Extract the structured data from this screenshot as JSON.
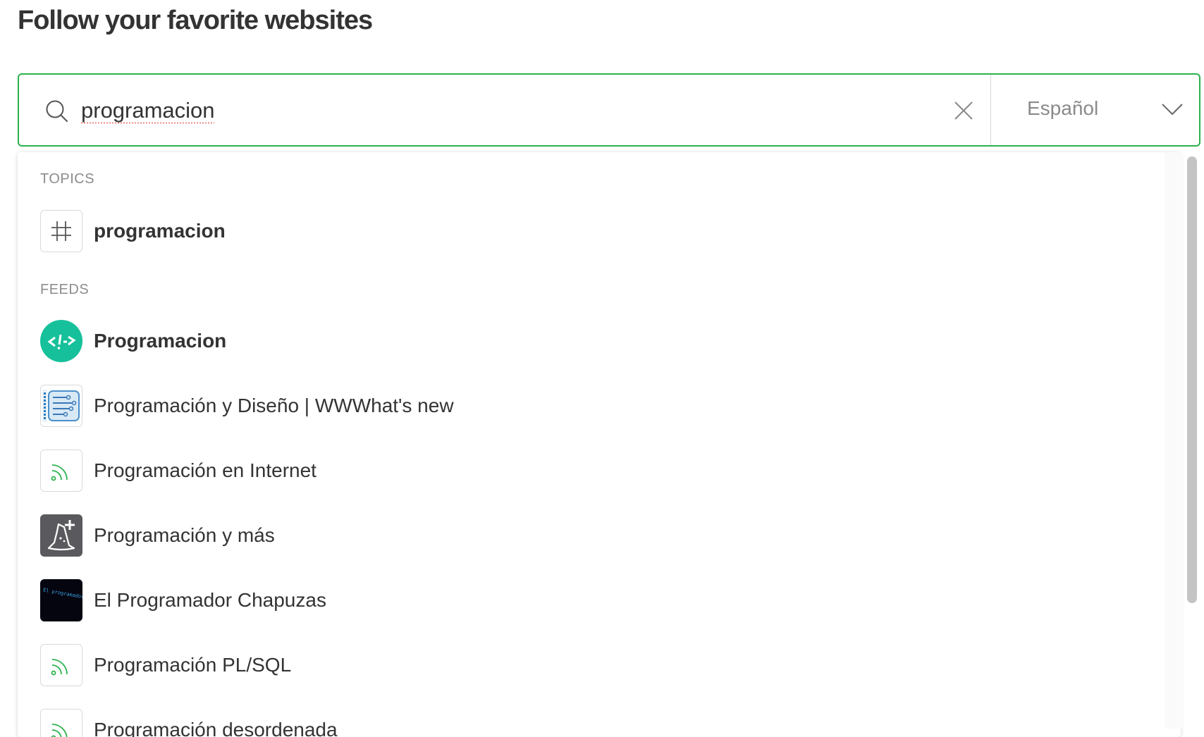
{
  "page": {
    "title": "Follow your favorite websites"
  },
  "search": {
    "value": "programacion",
    "language": "Español"
  },
  "dropdown": {
    "topics_label": "TOPICS",
    "topics": [
      {
        "label": "programacion",
        "icon": "hashtag-icon"
      }
    ],
    "feeds_label": "FEEDS",
    "feeds": [
      {
        "label": "Programacion",
        "icon": "code-logo-icon"
      },
      {
        "label": "Programación y Diseño | WWWhat's new",
        "icon": "wwwhatsnew-logo-icon"
      },
      {
        "label": "Programación en Internet",
        "icon": "rss-icon"
      },
      {
        "label": "Programación y más",
        "icon": "wizard-hat-logo-icon"
      },
      {
        "label": "El Programador Chapuzas",
        "icon": "chapuzas-logo-icon",
        "logo_text": "El programador Chapuzas"
      },
      {
        "label": "Programación PL/SQL",
        "icon": "rss-icon"
      },
      {
        "label": "Programación desordenada",
        "icon": "rss-icon"
      }
    ]
  },
  "colors": {
    "accent": "#2bb24c",
    "logo_teal": "#16c09a",
    "logo_dark": "#5a5a5e",
    "logo_black": "#050510",
    "logo_blue": "#3aa0e0"
  }
}
